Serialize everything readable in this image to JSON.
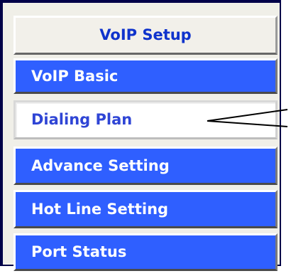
{
  "menu": {
    "header": "VoIP Setup",
    "items": [
      {
        "label": "VoIP Basic"
      },
      {
        "label": "Dialing Plan",
        "selected": true
      },
      {
        "label": "Advance Setting"
      },
      {
        "label": "Hot Line Setting"
      },
      {
        "label": "Port Status"
      }
    ]
  },
  "colors": {
    "frame_border": "#000048",
    "button_blue": "#2F5FFF",
    "header_text": "#0F33CC",
    "selected_text": "#2F45D5"
  },
  "annotation": {
    "pointer_icon": "callout-arrow-icon"
  }
}
